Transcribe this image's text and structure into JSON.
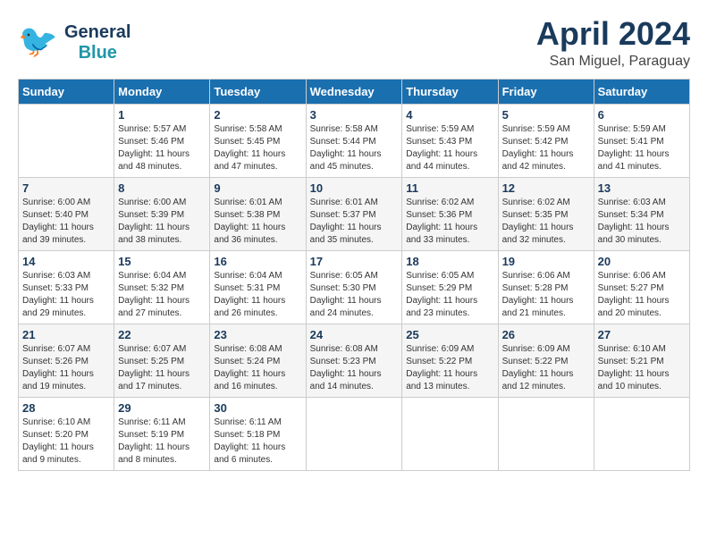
{
  "header": {
    "logo_general": "General",
    "logo_blue": "Blue",
    "month": "April 2024",
    "location": "San Miguel, Paraguay"
  },
  "days_of_week": [
    "Sunday",
    "Monday",
    "Tuesday",
    "Wednesday",
    "Thursday",
    "Friday",
    "Saturday"
  ],
  "weeks": [
    [
      {
        "day": "",
        "info": ""
      },
      {
        "day": "1",
        "info": "Sunrise: 5:57 AM\nSunset: 5:46 PM\nDaylight: 11 hours\nand 48 minutes."
      },
      {
        "day": "2",
        "info": "Sunrise: 5:58 AM\nSunset: 5:45 PM\nDaylight: 11 hours\nand 47 minutes."
      },
      {
        "day": "3",
        "info": "Sunrise: 5:58 AM\nSunset: 5:44 PM\nDaylight: 11 hours\nand 45 minutes."
      },
      {
        "day": "4",
        "info": "Sunrise: 5:59 AM\nSunset: 5:43 PM\nDaylight: 11 hours\nand 44 minutes."
      },
      {
        "day": "5",
        "info": "Sunrise: 5:59 AM\nSunset: 5:42 PM\nDaylight: 11 hours\nand 42 minutes."
      },
      {
        "day": "6",
        "info": "Sunrise: 5:59 AM\nSunset: 5:41 PM\nDaylight: 11 hours\nand 41 minutes."
      }
    ],
    [
      {
        "day": "7",
        "info": "Sunrise: 6:00 AM\nSunset: 5:40 PM\nDaylight: 11 hours\nand 39 minutes."
      },
      {
        "day": "8",
        "info": "Sunrise: 6:00 AM\nSunset: 5:39 PM\nDaylight: 11 hours\nand 38 minutes."
      },
      {
        "day": "9",
        "info": "Sunrise: 6:01 AM\nSunset: 5:38 PM\nDaylight: 11 hours\nand 36 minutes."
      },
      {
        "day": "10",
        "info": "Sunrise: 6:01 AM\nSunset: 5:37 PM\nDaylight: 11 hours\nand 35 minutes."
      },
      {
        "day": "11",
        "info": "Sunrise: 6:02 AM\nSunset: 5:36 PM\nDaylight: 11 hours\nand 33 minutes."
      },
      {
        "day": "12",
        "info": "Sunrise: 6:02 AM\nSunset: 5:35 PM\nDaylight: 11 hours\nand 32 minutes."
      },
      {
        "day": "13",
        "info": "Sunrise: 6:03 AM\nSunset: 5:34 PM\nDaylight: 11 hours\nand 30 minutes."
      }
    ],
    [
      {
        "day": "14",
        "info": "Sunrise: 6:03 AM\nSunset: 5:33 PM\nDaylight: 11 hours\nand 29 minutes."
      },
      {
        "day": "15",
        "info": "Sunrise: 6:04 AM\nSunset: 5:32 PM\nDaylight: 11 hours\nand 27 minutes."
      },
      {
        "day": "16",
        "info": "Sunrise: 6:04 AM\nSunset: 5:31 PM\nDaylight: 11 hours\nand 26 minutes."
      },
      {
        "day": "17",
        "info": "Sunrise: 6:05 AM\nSunset: 5:30 PM\nDaylight: 11 hours\nand 24 minutes."
      },
      {
        "day": "18",
        "info": "Sunrise: 6:05 AM\nSunset: 5:29 PM\nDaylight: 11 hours\nand 23 minutes."
      },
      {
        "day": "19",
        "info": "Sunrise: 6:06 AM\nSunset: 5:28 PM\nDaylight: 11 hours\nand 21 minutes."
      },
      {
        "day": "20",
        "info": "Sunrise: 6:06 AM\nSunset: 5:27 PM\nDaylight: 11 hours\nand 20 minutes."
      }
    ],
    [
      {
        "day": "21",
        "info": "Sunrise: 6:07 AM\nSunset: 5:26 PM\nDaylight: 11 hours\nand 19 minutes."
      },
      {
        "day": "22",
        "info": "Sunrise: 6:07 AM\nSunset: 5:25 PM\nDaylight: 11 hours\nand 17 minutes."
      },
      {
        "day": "23",
        "info": "Sunrise: 6:08 AM\nSunset: 5:24 PM\nDaylight: 11 hours\nand 16 minutes."
      },
      {
        "day": "24",
        "info": "Sunrise: 6:08 AM\nSunset: 5:23 PM\nDaylight: 11 hours\nand 14 minutes."
      },
      {
        "day": "25",
        "info": "Sunrise: 6:09 AM\nSunset: 5:22 PM\nDaylight: 11 hours\nand 13 minutes."
      },
      {
        "day": "26",
        "info": "Sunrise: 6:09 AM\nSunset: 5:22 PM\nDaylight: 11 hours\nand 12 minutes."
      },
      {
        "day": "27",
        "info": "Sunrise: 6:10 AM\nSunset: 5:21 PM\nDaylight: 11 hours\nand 10 minutes."
      }
    ],
    [
      {
        "day": "28",
        "info": "Sunrise: 6:10 AM\nSunset: 5:20 PM\nDaylight: 11 hours\nand 9 minutes."
      },
      {
        "day": "29",
        "info": "Sunrise: 6:11 AM\nSunset: 5:19 PM\nDaylight: 11 hours\nand 8 minutes."
      },
      {
        "day": "30",
        "info": "Sunrise: 6:11 AM\nSunset: 5:18 PM\nDaylight: 11 hours\nand 6 minutes."
      },
      {
        "day": "",
        "info": ""
      },
      {
        "day": "",
        "info": ""
      },
      {
        "day": "",
        "info": ""
      },
      {
        "day": "",
        "info": ""
      }
    ]
  ]
}
